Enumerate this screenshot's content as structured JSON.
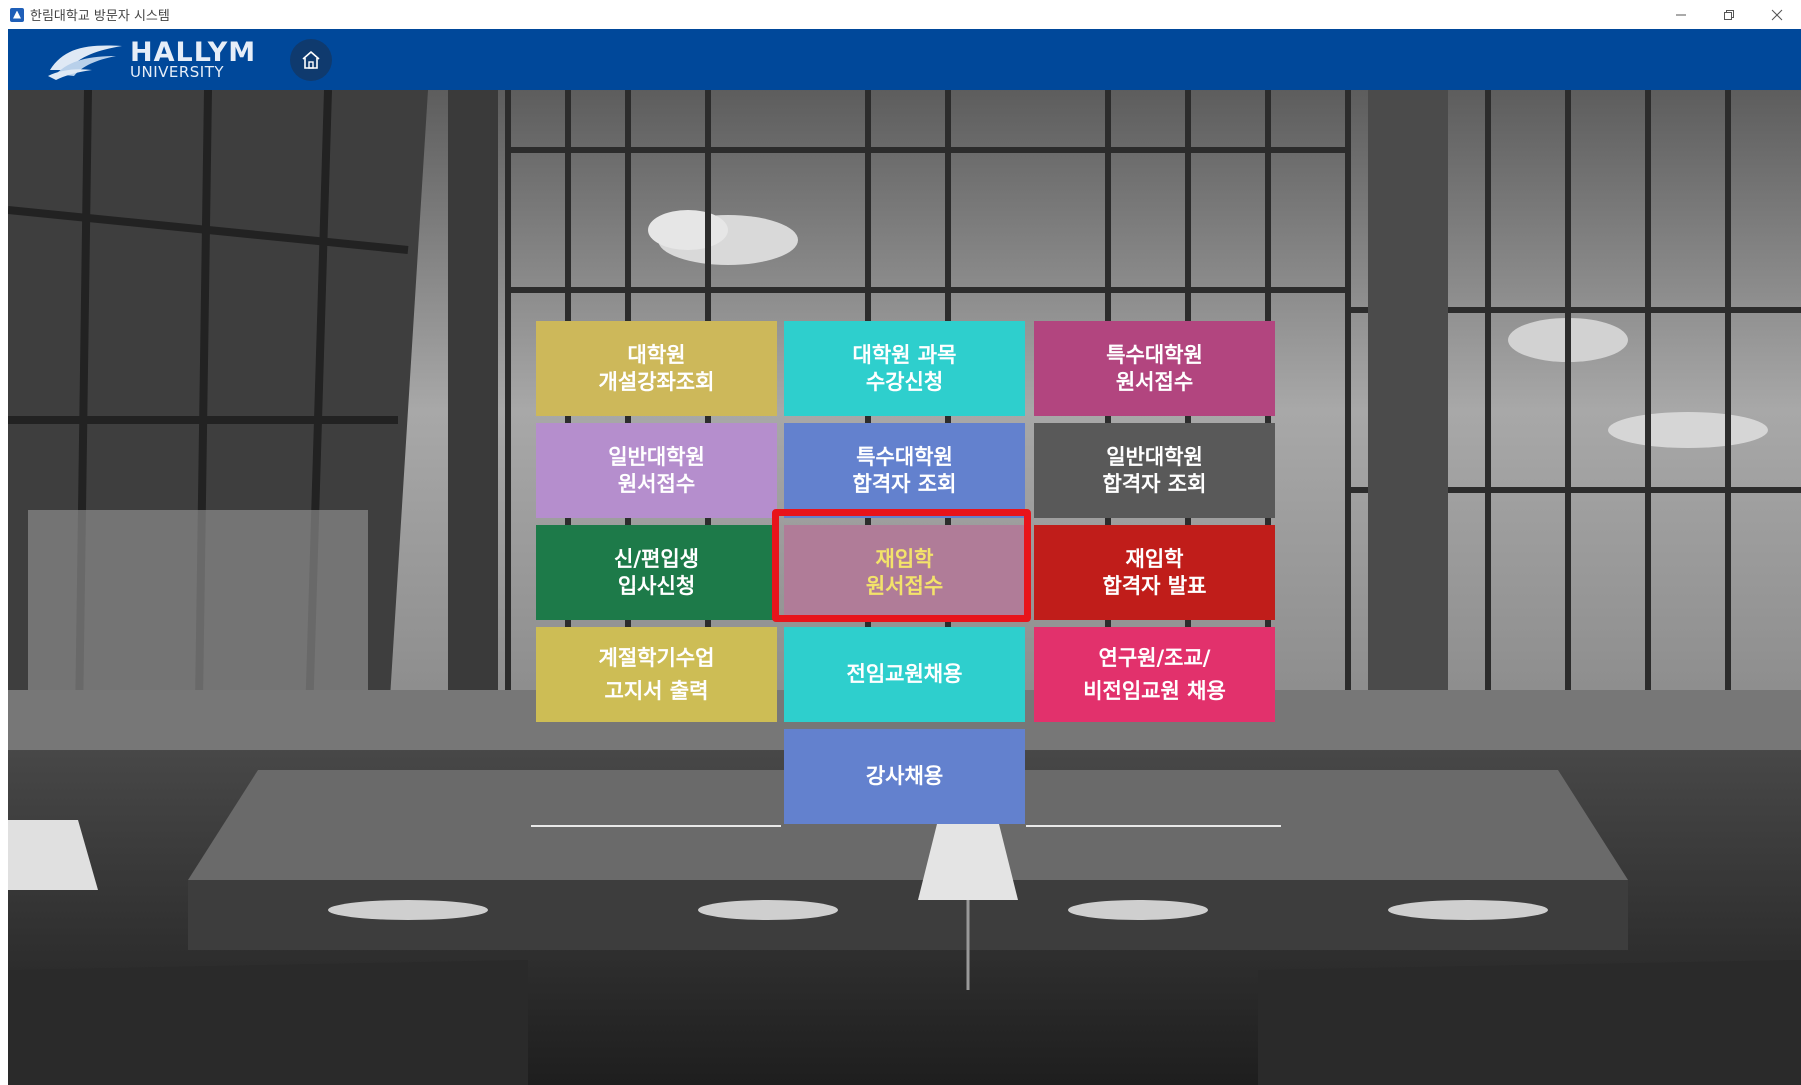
{
  "window": {
    "title": "한림대학교 방문자 시스템",
    "controls": [
      "minimize",
      "restore",
      "close"
    ]
  },
  "header": {
    "logo": {
      "line1": "HALLYM",
      "line2": "UNIVERSITY"
    },
    "home_icon": "home-icon",
    "background_color": "#00489a"
  },
  "menu": {
    "highlighted": "readmission-application",
    "tiles": [
      {
        "id": "grad-course-lookup",
        "lines": [
          "대학원",
          "개설강좌조회"
        ],
        "color": "#cdb85a"
      },
      {
        "id": "grad-course-registration",
        "lines": [
          "대학원 과목",
          "수강신청"
        ],
        "color": "#2ecfcd"
      },
      {
        "id": "special-grad-application",
        "lines": [
          "특수대학원",
          "원서접수"
        ],
        "color": "#b2457f"
      },
      {
        "id": "general-grad-application",
        "lines": [
          "일반대학원",
          "원서접수"
        ],
        "color": "#b58ecd"
      },
      {
        "id": "special-grad-results",
        "lines": [
          "특수대학원",
          "합격자 조회"
        ],
        "color": "#6381ce"
      },
      {
        "id": "general-grad-results",
        "lines": [
          "일반대학원",
          "합격자 조회"
        ],
        "color": "#595959"
      },
      {
        "id": "freshman-transfer-dorm",
        "lines": [
          "신/편입생",
          "입사신청"
        ],
        "color": "#1d7a49"
      },
      {
        "id": "readmission-application",
        "lines": [
          "재입학",
          "원서접수"
        ],
        "color": "#b07c98"
      },
      {
        "id": "readmission-results",
        "lines": [
          "재입학",
          "합격자 발표"
        ],
        "color": "#c01d1a"
      },
      {
        "id": "seasonal-invoice",
        "lines": [
          "계절학기수업",
          "고지서 출력"
        ],
        "color": "#cdbd55"
      },
      {
        "id": "fulltime-faculty-hiring",
        "lines": [
          "전임교원채용"
        ],
        "color": "#2ecfcd"
      },
      {
        "id": "research-assistant-hiring",
        "lines": [
          "연구원/조교/",
          "비전임교원 채용"
        ],
        "color": "#e2316c"
      },
      {
        "id": "lecturer-hiring",
        "lines": [
          "강사채용"
        ],
        "color": "#6381ce"
      }
    ]
  }
}
